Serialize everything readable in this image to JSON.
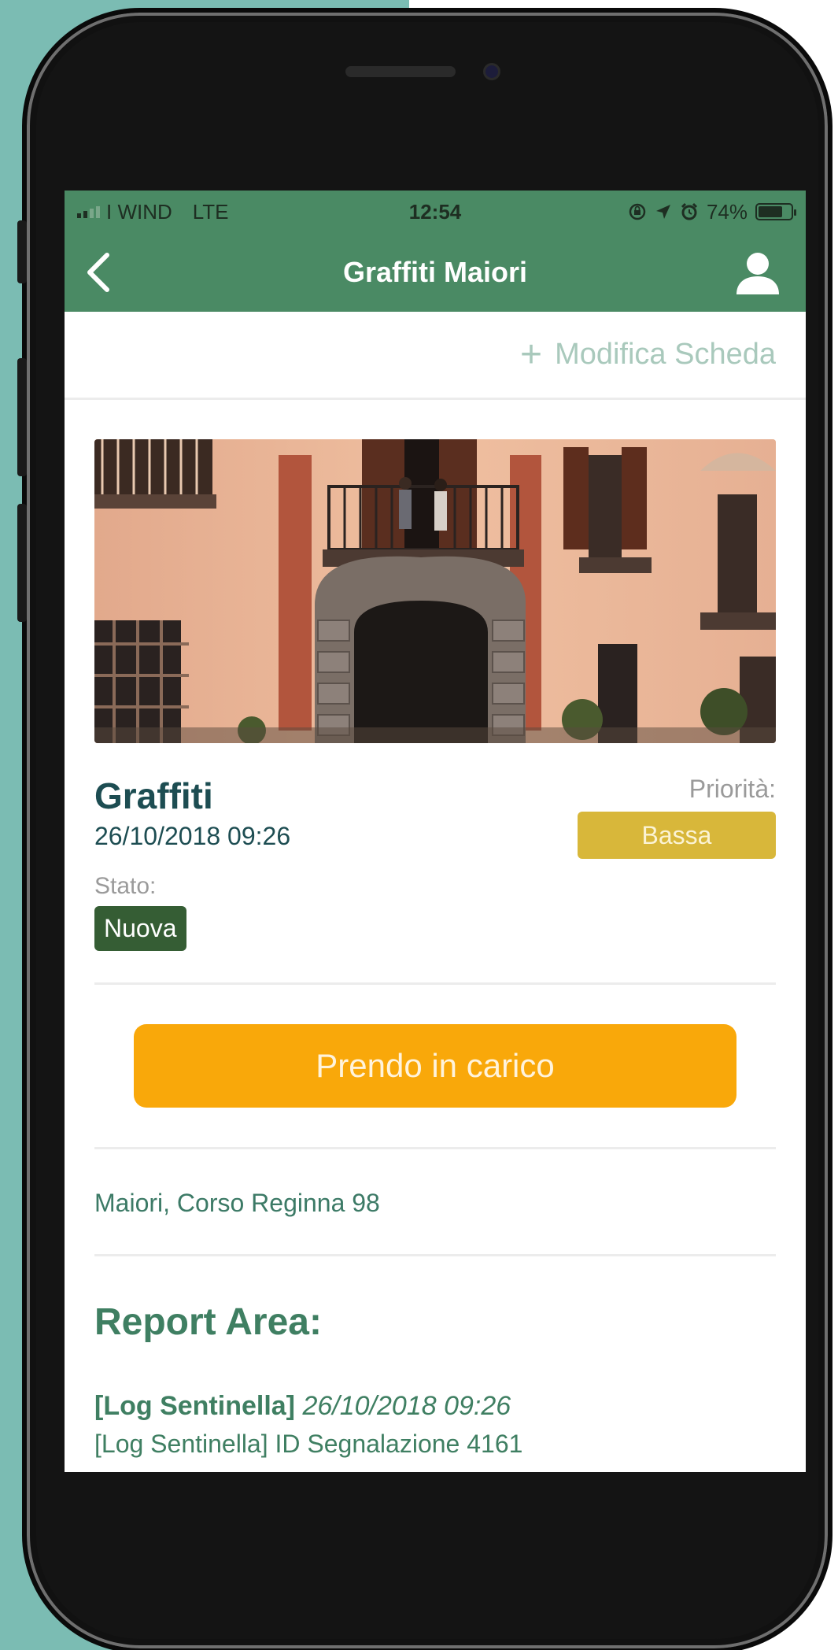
{
  "status_bar": {
    "carrier": "I WIND",
    "network": "LTE",
    "time": "12:54",
    "battery": "74%",
    "battery_level": 0.74
  },
  "nav": {
    "title": "Graffiti Maiori",
    "back_icon": "chevron-left-icon",
    "user_icon": "user-icon"
  },
  "toolbar": {
    "edit_label": "Modifica Scheda"
  },
  "report": {
    "title": "Graffiti",
    "datetime": "26/10/2018 09:26",
    "priority_label": "Priorità:",
    "priority_value": "Bassa",
    "state_label": "Stato:",
    "state_value": "Nuova",
    "action_label": "Prendo in carico",
    "address": "Maiori, Corso Reginna 98"
  },
  "report_area": {
    "heading": "Report Area:",
    "log": [
      {
        "source": "[Log Sentinella]",
        "timestamp": "26/10/2018 09:26"
      },
      {
        "text": "[Log Sentinella] ID Segnalazione 4161"
      }
    ]
  },
  "colors": {
    "header_green": "#4a8a64",
    "priority_yellow": "#d8b73a",
    "state_green": "#355d34",
    "cta_orange": "#f9a80a",
    "title_teal": "#1d4d52"
  }
}
